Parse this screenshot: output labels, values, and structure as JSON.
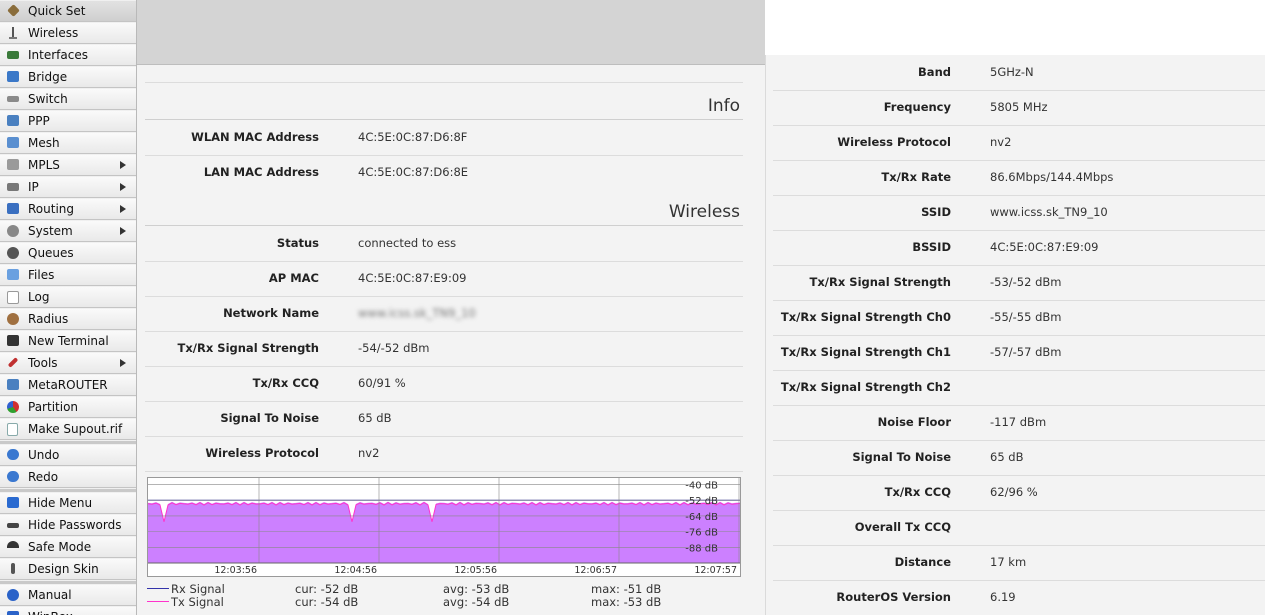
{
  "menu": [
    {
      "label": "Quick Set",
      "icon": "quick-set-icon"
    },
    {
      "label": "Wireless",
      "icon": "wireless-antenna-icon"
    },
    {
      "label": "Interfaces",
      "icon": "interfaces-icon"
    },
    {
      "label": "Bridge",
      "icon": "bridge-icon"
    },
    {
      "label": "Switch",
      "icon": "switch-icon"
    },
    {
      "label": "PPP",
      "icon": "ppp-icon"
    },
    {
      "label": "Mesh",
      "icon": "mesh-icon"
    },
    {
      "label": "MPLS",
      "icon": "mpls-icon",
      "arrow": true
    },
    {
      "label": "IP",
      "icon": "ip-icon",
      "arrow": true
    },
    {
      "label": "Routing",
      "icon": "routing-icon",
      "arrow": true
    },
    {
      "label": "System",
      "icon": "system-gear-icon",
      "arrow": true
    },
    {
      "label": "Queues",
      "icon": "queues-icon"
    },
    {
      "label": "Files",
      "icon": "files-folder-icon"
    },
    {
      "label": "Log",
      "icon": "log-icon"
    },
    {
      "label": "Radius",
      "icon": "radius-users-icon"
    },
    {
      "label": "New Terminal",
      "icon": "terminal-icon"
    },
    {
      "label": "Tools",
      "icon": "tools-icon",
      "arrow": true
    },
    {
      "label": "MetaROUTER",
      "icon": "metarouter-icon"
    },
    {
      "label": "Partition",
      "icon": "partition-pie-icon"
    },
    {
      "label": "Make Supout.rif",
      "icon": "supout-file-icon"
    },
    {
      "label": "Undo",
      "icon": "undo-arrow-icon"
    },
    {
      "label": "Redo",
      "icon": "redo-arrow-icon"
    },
    {
      "label": "Hide Menu",
      "icon": "hide-menu-icon"
    },
    {
      "label": "Hide Passwords",
      "icon": "hide-passwords-icon"
    },
    {
      "label": "Safe Mode",
      "icon": "umbrella-icon"
    },
    {
      "label": "Design Skin",
      "icon": "design-skin-icon"
    },
    {
      "label": "Manual",
      "icon": "help-question-icon"
    },
    {
      "label": "WinBox",
      "icon": "winbox-icon"
    }
  ],
  "info": {
    "title": "Info",
    "rows": [
      {
        "label": "WLAN MAC Address",
        "value": "4C:5E:0C:87:D6:8F"
      },
      {
        "label": "LAN MAC Address",
        "value": "4C:5E:0C:87:D6:8E"
      }
    ]
  },
  "wireless": {
    "title": "Wireless",
    "rows": [
      {
        "label": "Status",
        "value": "connected to ess"
      },
      {
        "label": "AP MAC",
        "value": "4C:5E:0C:87:E9:09"
      },
      {
        "label": "Network Name",
        "value": "www.icss.sk_TN9_10",
        "blurred": true
      },
      {
        "label": "Tx/Rx Signal Strength",
        "value": "-54/-52 dBm"
      },
      {
        "label": "Tx/Rx CCQ",
        "value": "60/91 %"
      },
      {
        "label": "Signal To Noise",
        "value": "65 dB"
      },
      {
        "label": "Wireless Protocol",
        "value": "nv2"
      }
    ]
  },
  "right": {
    "rows": [
      {
        "label": "Band",
        "value": "5GHz-N"
      },
      {
        "label": "Frequency",
        "value": "5805 MHz"
      },
      {
        "label": "Wireless Protocol",
        "value": "nv2"
      },
      {
        "label": "Tx/Rx Rate",
        "value": "86.6Mbps/144.4Mbps"
      },
      {
        "label": "SSID",
        "value": "www.icss.sk_TN9_10"
      },
      {
        "label": "BSSID",
        "value": "4C:5E:0C:87:E9:09"
      },
      {
        "label": "Tx/Rx Signal Strength",
        "value": "-53/-52 dBm"
      },
      {
        "label": "Tx/Rx Signal Strength Ch0",
        "value": "-55/-55 dBm"
      },
      {
        "label": "Tx/Rx Signal Strength Ch1",
        "value": "-57/-57 dBm"
      },
      {
        "label": "Tx/Rx Signal Strength Ch2",
        "value": ""
      },
      {
        "label": "Noise Floor",
        "value": "-117 dBm"
      },
      {
        "label": "Signal To Noise",
        "value": "65 dB"
      },
      {
        "label": "Tx/Rx CCQ",
        "value": "62/96 %"
      },
      {
        "label": "Overall Tx CCQ",
        "value": ""
      },
      {
        "label": "Distance",
        "value": "17 km"
      },
      {
        "label": "RouterOS Version",
        "value": "6.19"
      }
    ]
  },
  "graph": {
    "y_labels": [
      "-40 dB",
      "-52 dB",
      "-64 dB",
      "-76 dB",
      "-88 dB"
    ],
    "y_values": [
      -40,
      -52,
      -64,
      -76,
      -88
    ],
    "y_min": -100,
    "y_max": -35,
    "x_labels": [
      "12:03:56",
      "12:04:56",
      "12:05:56",
      "12:06:57",
      "12:07:57"
    ],
    "fill_color": "#cc80ff",
    "rx_color": "#3333aa",
    "tx_color": "#ff33cc",
    "legend": [
      {
        "name": "Rx Signal",
        "cur": "cur: -52 dB",
        "avg": "avg: -53 dB",
        "max": "max: -51 dB"
      },
      {
        "name": "Tx Signal",
        "cur": "cur: -54 dB",
        "avg": "avg: -54 dB",
        "max": "max: -53 dB"
      }
    ]
  }
}
